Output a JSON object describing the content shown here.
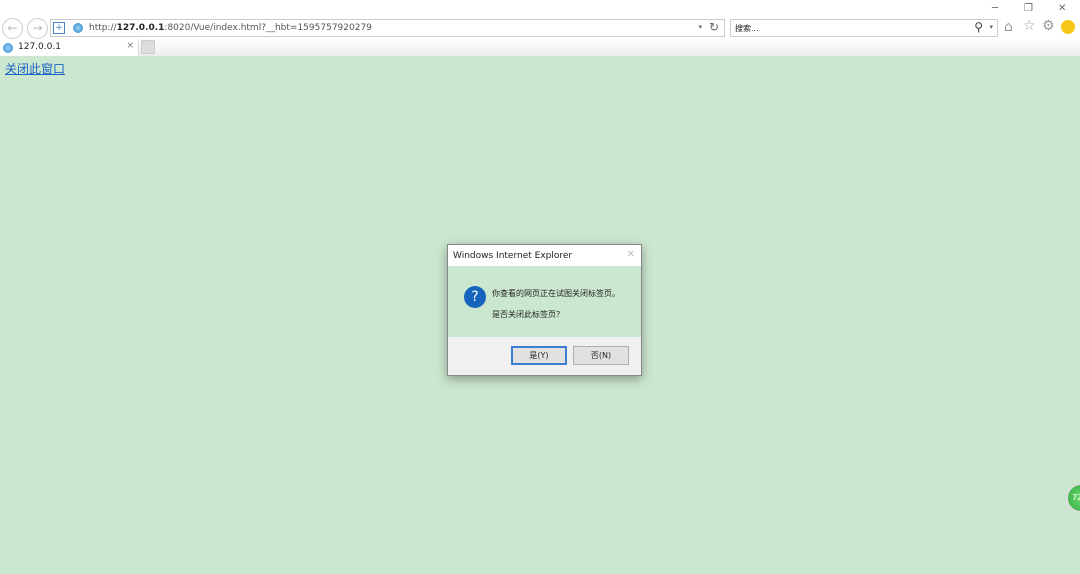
{
  "window": {
    "minimize": "─",
    "restore": "❐",
    "close": "✕"
  },
  "address_bar": {
    "url_prefix": "http://",
    "url_host": "127.0.0.1",
    "url_rest": ":8020/Vue/index.html?__hbt=1595757920279"
  },
  "search": {
    "placeholder": "搜索..."
  },
  "tab": {
    "label": "127.0.0.1",
    "close": "×"
  },
  "page": {
    "link": "关闭此窗口"
  },
  "dialog": {
    "title": "Windows Internet Explorer",
    "close": "✕",
    "icon": "?",
    "message": "你查看的网页正在试图关闭标签页。",
    "question": "是否关闭此标签页?",
    "yes": "是(Y)",
    "no": "否(N)"
  },
  "badge": {
    "text": "72"
  }
}
